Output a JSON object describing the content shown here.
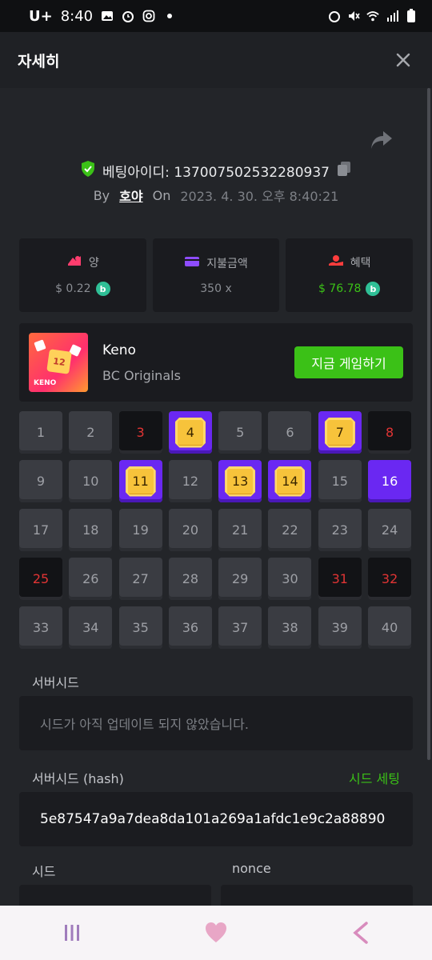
{
  "status": {
    "carrier": "U+",
    "time": "8:40"
  },
  "header": {
    "title": "자세히"
  },
  "bet": {
    "id_label": "베팅아이디: 137007502532280937",
    "by": "By",
    "user": "호야",
    "on": "On",
    "date": "2023. 4. 30. 오후 8:40:21"
  },
  "stats": [
    {
      "label": "양",
      "value": "$ 0.22",
      "icon": "wager-icon",
      "color": "#ff3d6e"
    },
    {
      "label": "지불금액",
      "value": "350 x",
      "icon": "wallet-icon",
      "color": "#8e4cff"
    },
    {
      "label": "혜택",
      "value": "$ 76.78",
      "icon": "profit-icon",
      "color": "#ff3d3d"
    }
  ],
  "game": {
    "name": "Keno",
    "provider": "BC Originals",
    "play_label": "지금 게임하기",
    "thumb_number": "12",
    "thumb_label": "KENO"
  },
  "grid": [
    {
      "n": "1",
      "s": "none"
    },
    {
      "n": "2",
      "s": "none"
    },
    {
      "n": "3",
      "s": "miss"
    },
    {
      "n": "4",
      "s": "hit"
    },
    {
      "n": "5",
      "s": "none"
    },
    {
      "n": "6",
      "s": "none"
    },
    {
      "n": "7",
      "s": "hit"
    },
    {
      "n": "8",
      "s": "miss"
    },
    {
      "n": "9",
      "s": "none"
    },
    {
      "n": "10",
      "s": "none"
    },
    {
      "n": "11",
      "s": "hit"
    },
    {
      "n": "12",
      "s": "none"
    },
    {
      "n": "13",
      "s": "hit"
    },
    {
      "n": "14",
      "s": "hit"
    },
    {
      "n": "15",
      "s": "none"
    },
    {
      "n": "16",
      "s": "pick"
    },
    {
      "n": "17",
      "s": "none"
    },
    {
      "n": "18",
      "s": "none"
    },
    {
      "n": "19",
      "s": "none"
    },
    {
      "n": "20",
      "s": "none"
    },
    {
      "n": "21",
      "s": "none"
    },
    {
      "n": "22",
      "s": "none"
    },
    {
      "n": "23",
      "s": "none"
    },
    {
      "n": "24",
      "s": "none"
    },
    {
      "n": "25",
      "s": "miss"
    },
    {
      "n": "26",
      "s": "none"
    },
    {
      "n": "27",
      "s": "none"
    },
    {
      "n": "28",
      "s": "none"
    },
    {
      "n": "29",
      "s": "none"
    },
    {
      "n": "30",
      "s": "none"
    },
    {
      "n": "31",
      "s": "miss"
    },
    {
      "n": "32",
      "s": "miss"
    },
    {
      "n": "33",
      "s": "none"
    },
    {
      "n": "34",
      "s": "none"
    },
    {
      "n": "35",
      "s": "none"
    },
    {
      "n": "36",
      "s": "none"
    },
    {
      "n": "37",
      "s": "none"
    },
    {
      "n": "38",
      "s": "none"
    },
    {
      "n": "39",
      "s": "none"
    },
    {
      "n": "40",
      "s": "none"
    }
  ],
  "server_seed": {
    "label": "서버시드",
    "value": "시드가 아직 업데이트 되지 않았습니다."
  },
  "server_seed_hash": {
    "label": "서버시드 (hash)",
    "action": "시드 세팅",
    "value": "5e87547a9a7dea8da101a269a1afdc1e9c2a88890"
  },
  "client": {
    "seed_label": "시드",
    "nonce_label": "nonce"
  }
}
